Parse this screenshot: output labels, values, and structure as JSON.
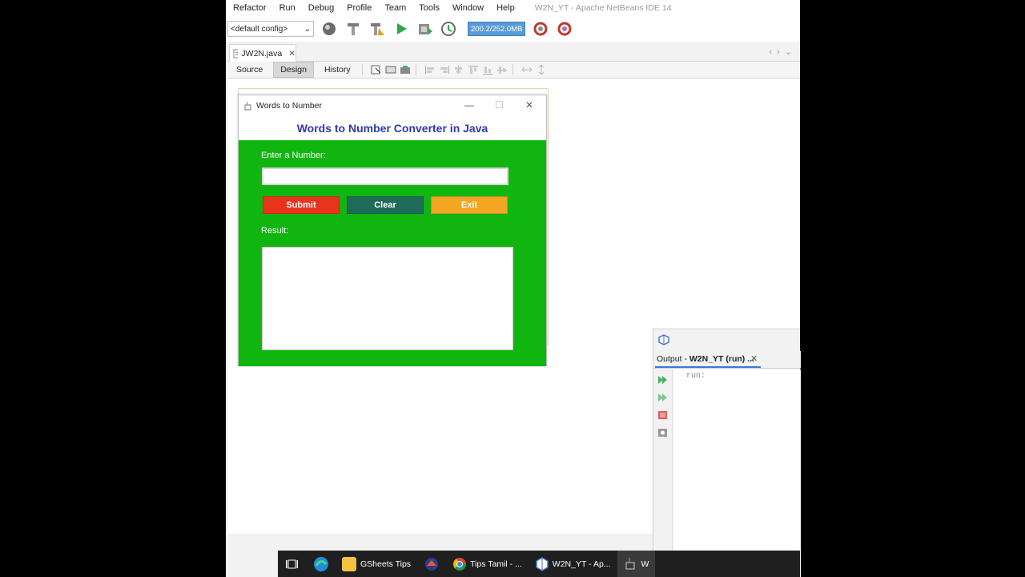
{
  "menu": {
    "items": [
      "Refactor",
      "Run",
      "Debug",
      "Profile",
      "Team",
      "Tools",
      "Window",
      "Help"
    ],
    "window_title": "W2N_YT - Apache NetBeans IDE 14"
  },
  "toolbar": {
    "config_value": "<default config>",
    "memory_label": "200.2/252.0MB"
  },
  "editor": {
    "file_tab": "JW2N.java",
    "close_glyph": "✕",
    "view_tabs": [
      "Source",
      "Design",
      "History"
    ],
    "active_view": "Design"
  },
  "app_window": {
    "title": "Words to Number",
    "controls": {
      "minimize": "—",
      "maximize": "☐",
      "close": "✕"
    },
    "heading": "Words to Number Converter in Java",
    "number_label": "Enter a Number:",
    "number_value": "",
    "result_label": "Result:",
    "buttons": {
      "submit": "Submit",
      "clear": "Clear",
      "exit": "Exit"
    },
    "colors": {
      "panel": "#10b510",
      "submit": "#e8341c",
      "clear": "#1e6b5a",
      "exit": "#f2a623",
      "heading": "#2e3aa8"
    }
  },
  "output": {
    "tab_label": "Output - W2N_YT (run) ...",
    "tab_prefix": "Output - ",
    "tab_name": "W2N_YT (run) ...",
    "close_glyph": "✕",
    "text": "run:"
  },
  "taskbar": {
    "apps": [
      "GSheets Tips",
      "Tips Tamil - ...",
      "W2N_YT - Ap...",
      "W"
    ]
  }
}
